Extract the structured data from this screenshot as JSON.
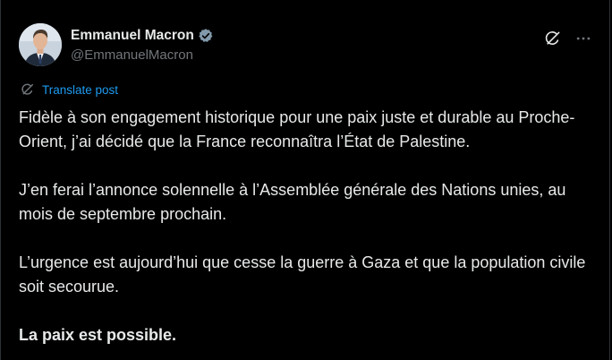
{
  "author": {
    "display_name": "Emmanuel Macron",
    "handle": "@EmmanuelMacron",
    "verified": true,
    "avatar_icon": "avatar-portrait"
  },
  "actions": {
    "grok_icon": "grok-icon",
    "more_icon": "more-dots-icon"
  },
  "translate": {
    "label": "Translate post",
    "icon": "translate-grok-icon"
  },
  "post": {
    "paragraphs": [
      "Fidèle à son engagement historique pour une paix juste et durable au Proche-Orient, j’ai décidé que la France reconnaîtra l’État de Palestine.",
      "J’en ferai l’annonce solennelle à l’Assemblée générale des Nations unies, au mois de septembre prochain.",
      "L’urgence est aujourd’hui que cesse la guerre à Gaza et que la population civile soit secourue.",
      "La paix est possible."
    ]
  },
  "colors": {
    "background": "#000000",
    "text": "#e7e9ea",
    "secondary": "#71767b",
    "link": "#1d9bf0",
    "verified_badge": "#829aab"
  }
}
